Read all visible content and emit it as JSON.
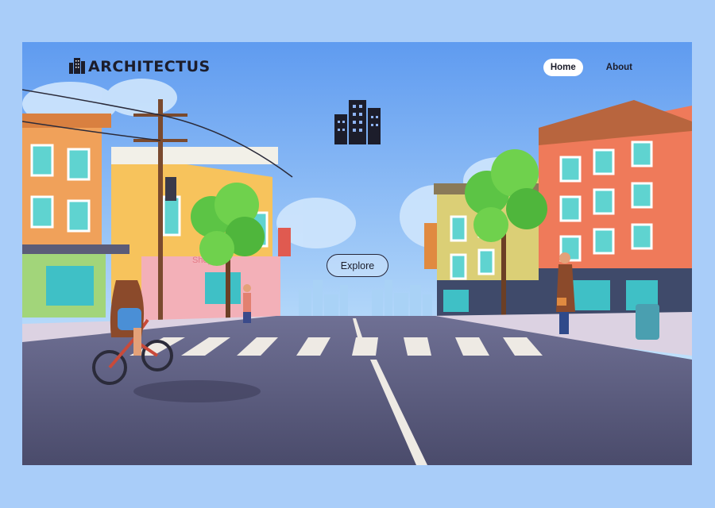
{
  "brand": {
    "name": "ARCHITECTUS",
    "logo_icon": "city-buildings-icon"
  },
  "nav": {
    "items": [
      {
        "label": "Home",
        "active": true
      },
      {
        "label": "About",
        "active": false
      }
    ]
  },
  "hero": {
    "icon": "city-buildings-icon",
    "button_label": "Explore",
    "illustration_sign": "Shop"
  },
  "colors": {
    "page_bg": "#a9cdf9",
    "sky": "#6fa6f3",
    "road": "#58597a",
    "ink": "#1c1d2b"
  }
}
